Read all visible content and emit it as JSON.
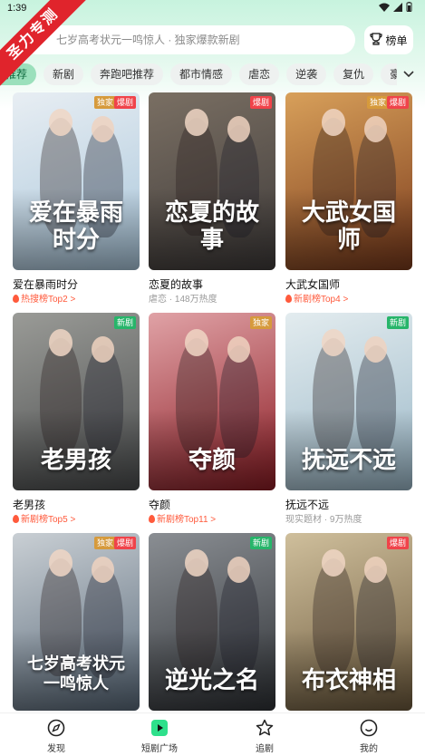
{
  "status": {
    "time": "1:39"
  },
  "watermark": "圣力专测",
  "search": {
    "placeholder": "七岁高考状元一鸣惊人 · 独家爆款新剧"
  },
  "rank_button": {
    "label": "榜单"
  },
  "tabs": [
    {
      "label": "推荐",
      "active": true
    },
    {
      "label": "新剧"
    },
    {
      "label": "奔跑吧推荐"
    },
    {
      "label": "都市情感"
    },
    {
      "label": "虐恋"
    },
    {
      "label": "逆袭"
    },
    {
      "label": "复仇"
    },
    {
      "label": "豪门"
    }
  ],
  "cards": [
    {
      "title": "爱在暴雨时分",
      "sub": "热搜榜Top2 >",
      "sub_style": "hot",
      "badges": [
        "独家",
        "爆剧"
      ],
      "art": "爱在暴雨时分",
      "colors": [
        "#a9c6db",
        "#e8eef3"
      ]
    },
    {
      "title": "恋夏的故事",
      "sub": "虐恋 · 148万热度",
      "sub_style": "gray",
      "badges": [
        "爆剧"
      ],
      "art": "恋夏的故事",
      "colors": [
        "#3f3b3a",
        "#7a6f63"
      ]
    },
    {
      "title": "大武女国师",
      "sub": "新剧榜Top4 >",
      "sub_style": "hot",
      "badges": [
        "独家",
        "爆剧"
      ],
      "art": "大武女国师",
      "colors": [
        "#7a3a1c",
        "#d8a05a"
      ]
    },
    {
      "title": "老男孩",
      "sub": "新剧榜Top5 >",
      "sub_style": "hot",
      "badges": [
        "新剧"
      ],
      "art": "老男孩",
      "colors": [
        "#4a4c4d",
        "#9a9b97"
      ]
    },
    {
      "title": "夺颜",
      "sub": "新剧榜Top11 >",
      "sub_style": "hot",
      "badges": [
        "独家"
      ],
      "art": "夺颜",
      "colors": [
        "#8c1c24",
        "#e0a2a6"
      ]
    },
    {
      "title": "抚远不远",
      "sub": "现实题材 · 9万热度",
      "sub_style": "gray",
      "badges": [
        "新剧"
      ],
      "art": "抚远不远",
      "colors": [
        "#9bb8c8",
        "#e3ecef"
      ]
    },
    {
      "title": "七岁高考状元一鸣惊人",
      "sub": "",
      "sub_style": "gray",
      "badges": [
        "独家",
        "爆剧"
      ],
      "art": "七岁高考状元一鸣惊人",
      "colors": [
        "#5a6a7a",
        "#c9cfd4"
      ]
    },
    {
      "title": "逆光之名",
      "sub": "",
      "sub_style": "gray",
      "badges": [
        "新剧"
      ],
      "art": "逆光之名",
      "colors": [
        "#2f3236",
        "#8a8e93"
      ]
    },
    {
      "title": "布衣神相",
      "sub": "",
      "sub_style": "gray",
      "badges": [
        "爆剧"
      ],
      "art": "布衣神相",
      "colors": [
        "#6d5a3d",
        "#cfbf9c"
      ]
    }
  ],
  "badge_colors": {
    "独家": "#d69a3c",
    "爆剧": "#f0434a",
    "新剧": "#27b56a"
  },
  "nav": [
    {
      "label": "发现",
      "icon": "compass-icon"
    },
    {
      "label": "短剧广场",
      "icon": "play-square-icon",
      "active": true
    },
    {
      "label": "追剧",
      "icon": "star-icon"
    },
    {
      "label": "我的",
      "icon": "smiley-icon"
    }
  ]
}
